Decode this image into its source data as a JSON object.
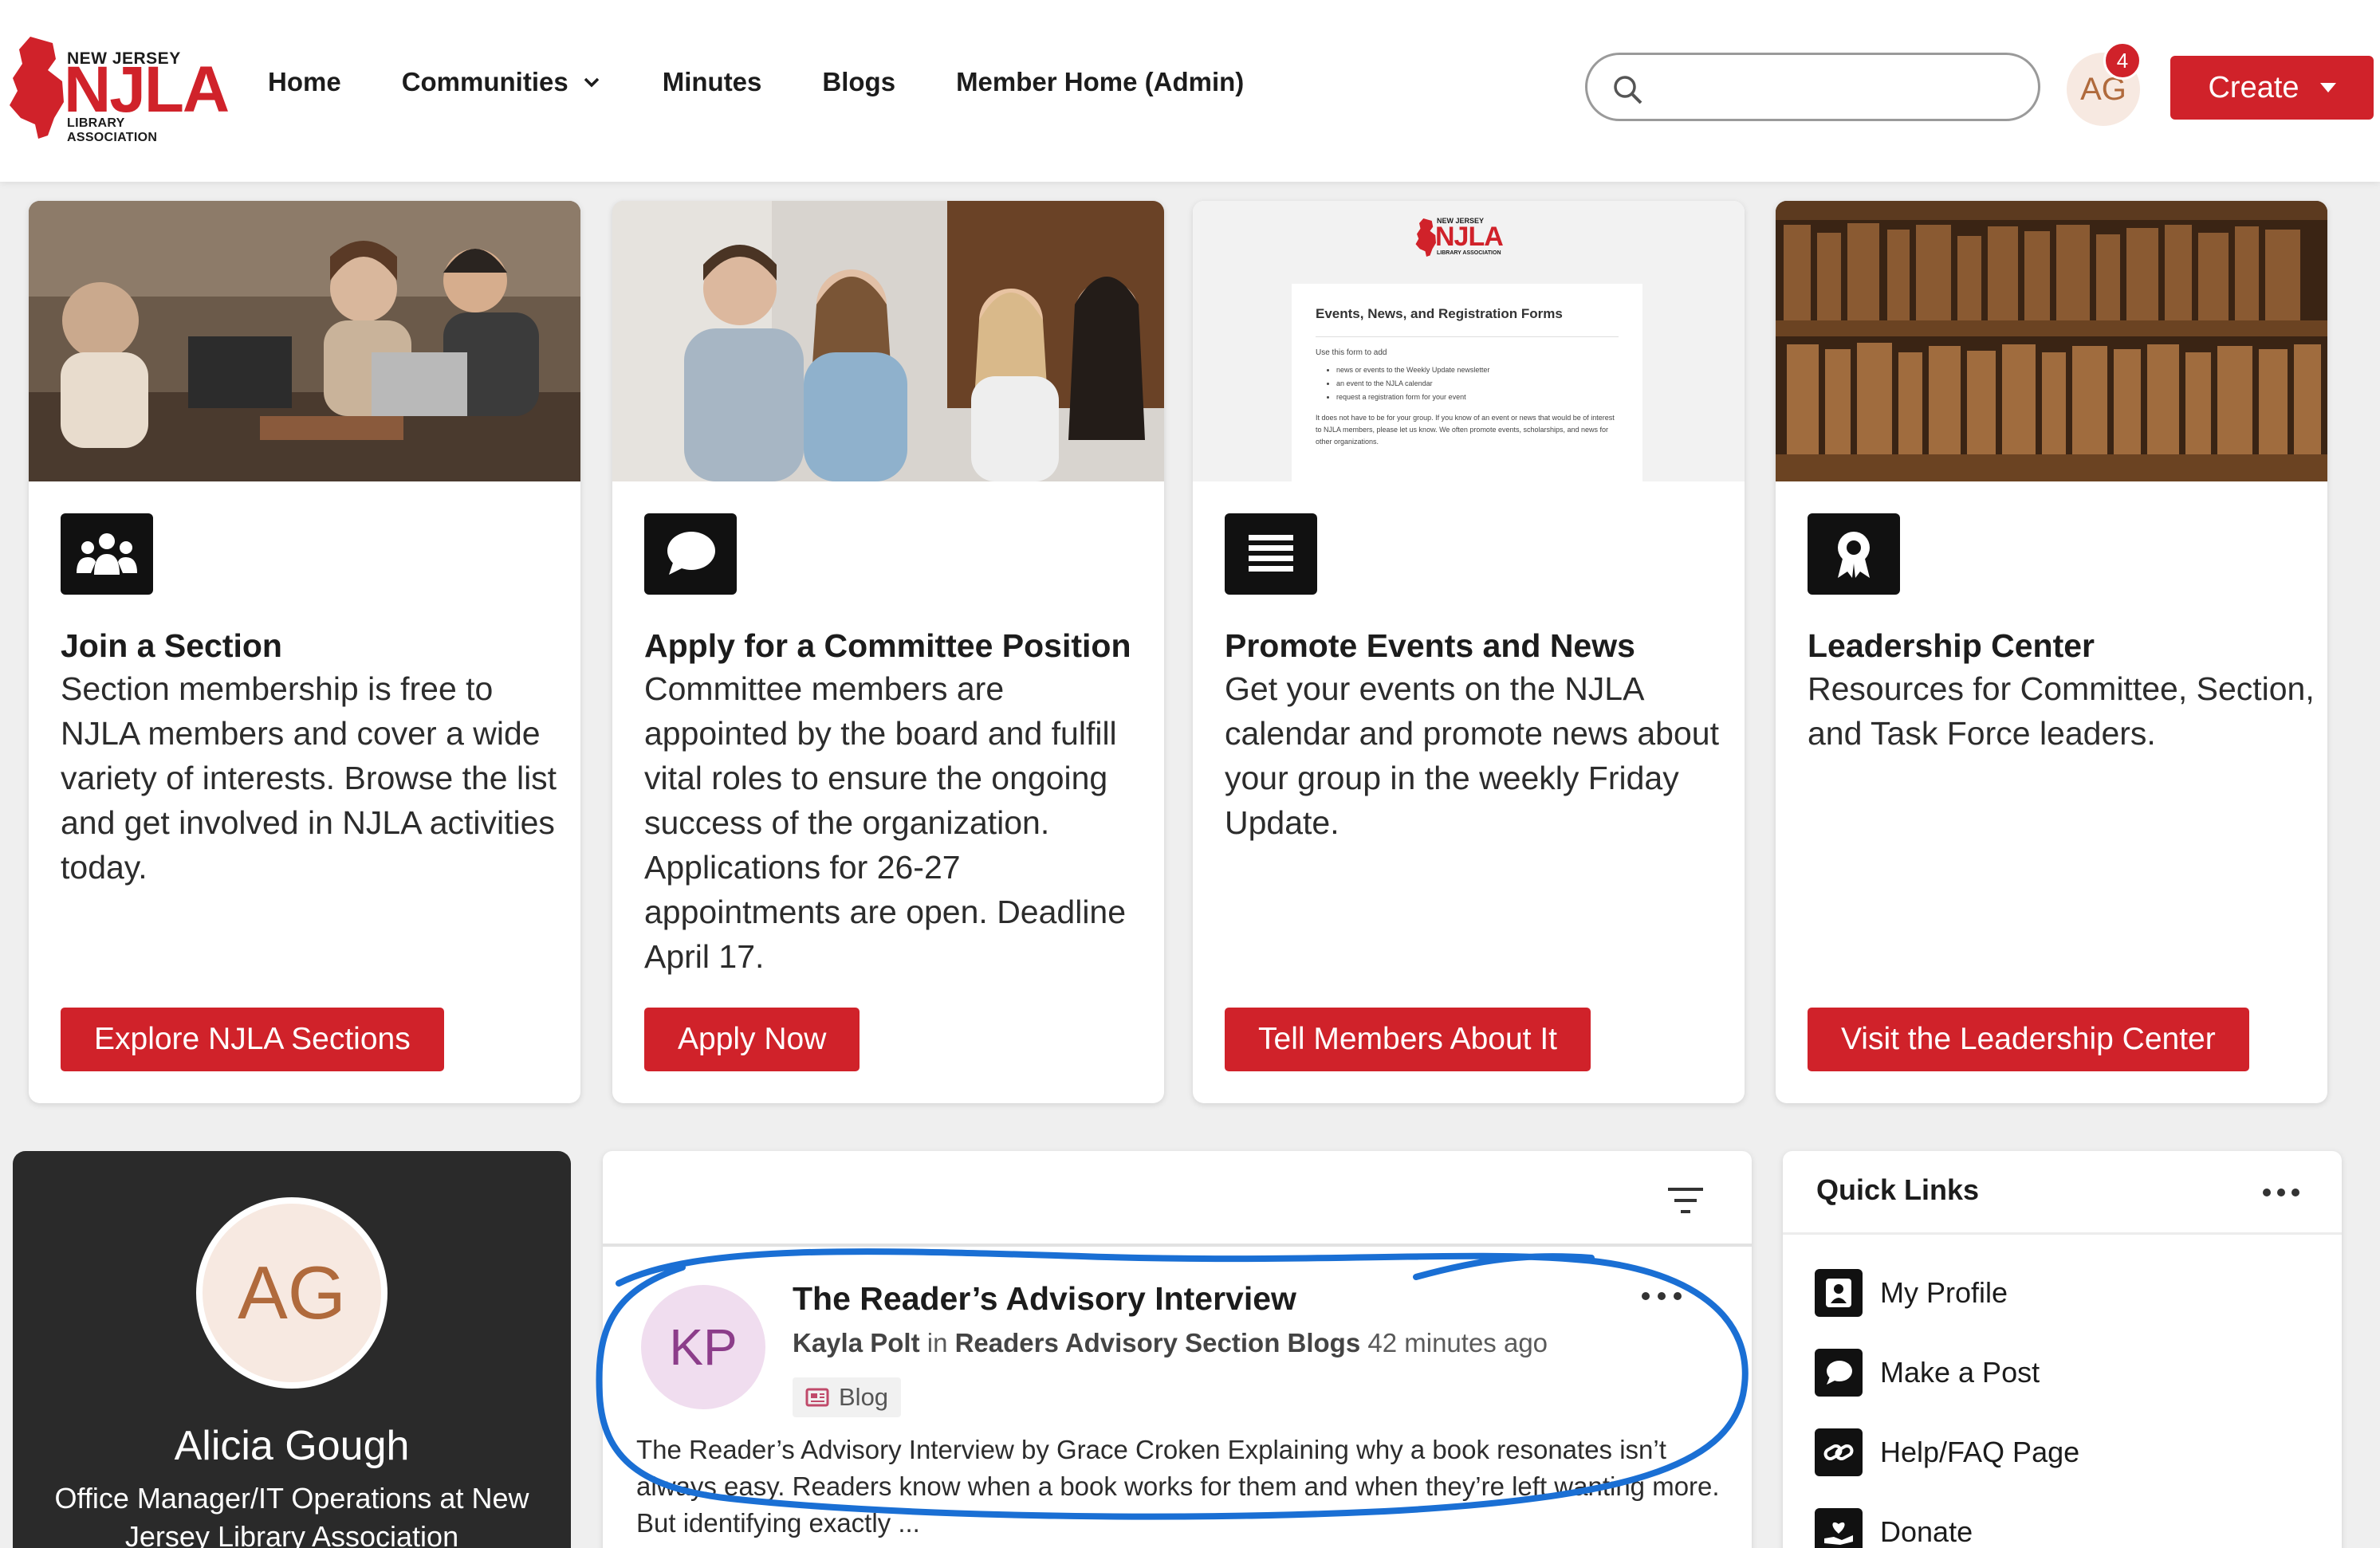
{
  "header": {
    "logo": {
      "top": "NEW JERSEY",
      "main": "NJLA",
      "sub": "LIBRARY ASSOCIATION"
    },
    "nav": [
      "Home",
      "Communities",
      "Minutes",
      "Blogs",
      "Member Home (Admin)"
    ],
    "search": {
      "placeholder": "",
      "value": ""
    },
    "avatar_initials": "AG",
    "notification_count": "4",
    "create_label": "Create"
  },
  "cards": [
    {
      "title": "Join a Section",
      "text": "Section membership is free to NJLA members and cover a wide variety of interests. Browse the list and get involved in NJLA activities today.",
      "button": "Explore NJLA Sections",
      "icon": "people-group-icon"
    },
    {
      "title": "Apply for a Committee Position",
      "text": "Committee members are appointed by the board and fulfill vital roles to ensure the ongoing success of the organization. Applications for 26-27 appointments are open. Deadline April 17.",
      "button": "Apply Now",
      "icon": "speech-bubble-icon"
    },
    {
      "title": "Promote Events and News",
      "text": "Get your events on the NJLA calendar and promote news about your group in the weekly Friday Update.",
      "button": "Tell Members About It",
      "icon": "list-lines-icon",
      "preview": {
        "heading": "Events, News, and Registration Forms",
        "intro": "Use this form to add",
        "bullets": [
          "news or events to the Weekly Update newsletter",
          "an event to the NJLA calendar",
          "request a registration form for your event"
        ],
        "note": "It does not have to be for your group. If you know of an event or news that would be of interest to NJLA members, please let us know. We often promote events, scholarships, and news for other organizations."
      }
    },
    {
      "title": "Leadership Center",
      "text": "Resources for Committee, Section, and Task Force leaders.",
      "button": "Visit the Leadership Center",
      "icon": "award-ribbon-icon"
    }
  ],
  "profile": {
    "initials": "AG",
    "name": "Alicia Gough",
    "role": "Office Manager/IT Operations at New Jersey Library Association"
  },
  "feed": {
    "post": {
      "initials": "KP",
      "title": "The Reader’s Advisory Interview",
      "author": "Kayla Polt",
      "in_label": "in",
      "group": "Readers Advisory Section Blogs",
      "time": "42 minutes ago",
      "tag": "Blog",
      "excerpt": "The Reader’s Advisory Interview by Grace Croken Explaining why a book resonates isn’t always easy. Readers know when a book works for them and when they’re left wanting more. But identifying exactly ..."
    }
  },
  "quick_links": {
    "title": "Quick Links",
    "items": [
      {
        "label": "My Profile",
        "icon": "profile-card-icon"
      },
      {
        "label": "Make a Post",
        "icon": "speech-bubble-icon"
      },
      {
        "label": "Help/FAQ Page",
        "icon": "link-icon"
      },
      {
        "label": "Donate",
        "icon": "hand-heart-icon"
      }
    ]
  },
  "colors": {
    "brand_red": "#d0222a",
    "profile_bg": "#2a2a2a",
    "annotation_blue": "#1a6fd4"
  }
}
